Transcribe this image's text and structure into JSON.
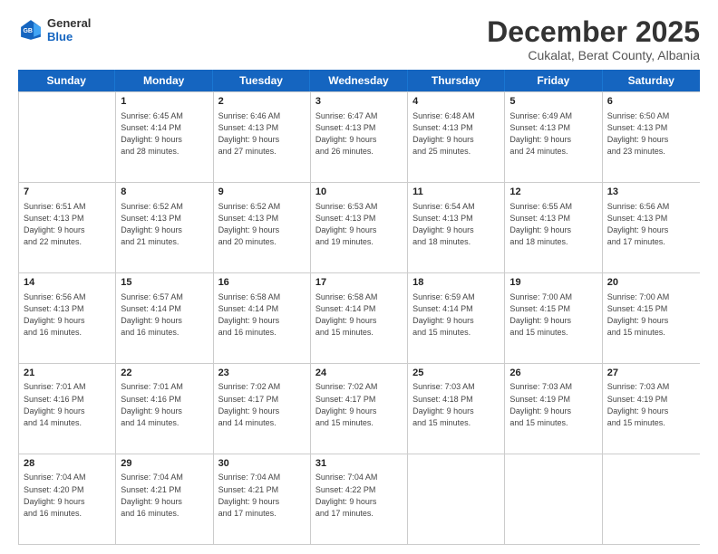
{
  "logo": {
    "line1": "General",
    "line2": "Blue"
  },
  "title": "December 2025",
  "subtitle": "Cukalat, Berat County, Albania",
  "header_days": [
    "Sunday",
    "Monday",
    "Tuesday",
    "Wednesday",
    "Thursday",
    "Friday",
    "Saturday"
  ],
  "weeks": [
    [
      {
        "day": "",
        "info": ""
      },
      {
        "day": "1",
        "info": "Sunrise: 6:45 AM\nSunset: 4:14 PM\nDaylight: 9 hours\nand 28 minutes."
      },
      {
        "day": "2",
        "info": "Sunrise: 6:46 AM\nSunset: 4:13 PM\nDaylight: 9 hours\nand 27 minutes."
      },
      {
        "day": "3",
        "info": "Sunrise: 6:47 AM\nSunset: 4:13 PM\nDaylight: 9 hours\nand 26 minutes."
      },
      {
        "day": "4",
        "info": "Sunrise: 6:48 AM\nSunset: 4:13 PM\nDaylight: 9 hours\nand 25 minutes."
      },
      {
        "day": "5",
        "info": "Sunrise: 6:49 AM\nSunset: 4:13 PM\nDaylight: 9 hours\nand 24 minutes."
      },
      {
        "day": "6",
        "info": "Sunrise: 6:50 AM\nSunset: 4:13 PM\nDaylight: 9 hours\nand 23 minutes."
      }
    ],
    [
      {
        "day": "7",
        "info": "Sunrise: 6:51 AM\nSunset: 4:13 PM\nDaylight: 9 hours\nand 22 minutes."
      },
      {
        "day": "8",
        "info": "Sunrise: 6:52 AM\nSunset: 4:13 PM\nDaylight: 9 hours\nand 21 minutes."
      },
      {
        "day": "9",
        "info": "Sunrise: 6:52 AM\nSunset: 4:13 PM\nDaylight: 9 hours\nand 20 minutes."
      },
      {
        "day": "10",
        "info": "Sunrise: 6:53 AM\nSunset: 4:13 PM\nDaylight: 9 hours\nand 19 minutes."
      },
      {
        "day": "11",
        "info": "Sunrise: 6:54 AM\nSunset: 4:13 PM\nDaylight: 9 hours\nand 18 minutes."
      },
      {
        "day": "12",
        "info": "Sunrise: 6:55 AM\nSunset: 4:13 PM\nDaylight: 9 hours\nand 18 minutes."
      },
      {
        "day": "13",
        "info": "Sunrise: 6:56 AM\nSunset: 4:13 PM\nDaylight: 9 hours\nand 17 minutes."
      }
    ],
    [
      {
        "day": "14",
        "info": "Sunrise: 6:56 AM\nSunset: 4:13 PM\nDaylight: 9 hours\nand 16 minutes."
      },
      {
        "day": "15",
        "info": "Sunrise: 6:57 AM\nSunset: 4:14 PM\nDaylight: 9 hours\nand 16 minutes."
      },
      {
        "day": "16",
        "info": "Sunrise: 6:58 AM\nSunset: 4:14 PM\nDaylight: 9 hours\nand 16 minutes."
      },
      {
        "day": "17",
        "info": "Sunrise: 6:58 AM\nSunset: 4:14 PM\nDaylight: 9 hours\nand 15 minutes."
      },
      {
        "day": "18",
        "info": "Sunrise: 6:59 AM\nSunset: 4:14 PM\nDaylight: 9 hours\nand 15 minutes."
      },
      {
        "day": "19",
        "info": "Sunrise: 7:00 AM\nSunset: 4:15 PM\nDaylight: 9 hours\nand 15 minutes."
      },
      {
        "day": "20",
        "info": "Sunrise: 7:00 AM\nSunset: 4:15 PM\nDaylight: 9 hours\nand 15 minutes."
      }
    ],
    [
      {
        "day": "21",
        "info": "Sunrise: 7:01 AM\nSunset: 4:16 PM\nDaylight: 9 hours\nand 14 minutes."
      },
      {
        "day": "22",
        "info": "Sunrise: 7:01 AM\nSunset: 4:16 PM\nDaylight: 9 hours\nand 14 minutes."
      },
      {
        "day": "23",
        "info": "Sunrise: 7:02 AM\nSunset: 4:17 PM\nDaylight: 9 hours\nand 14 minutes."
      },
      {
        "day": "24",
        "info": "Sunrise: 7:02 AM\nSunset: 4:17 PM\nDaylight: 9 hours\nand 15 minutes."
      },
      {
        "day": "25",
        "info": "Sunrise: 7:03 AM\nSunset: 4:18 PM\nDaylight: 9 hours\nand 15 minutes."
      },
      {
        "day": "26",
        "info": "Sunrise: 7:03 AM\nSunset: 4:19 PM\nDaylight: 9 hours\nand 15 minutes."
      },
      {
        "day": "27",
        "info": "Sunrise: 7:03 AM\nSunset: 4:19 PM\nDaylight: 9 hours\nand 15 minutes."
      }
    ],
    [
      {
        "day": "28",
        "info": "Sunrise: 7:04 AM\nSunset: 4:20 PM\nDaylight: 9 hours\nand 16 minutes."
      },
      {
        "day": "29",
        "info": "Sunrise: 7:04 AM\nSunset: 4:21 PM\nDaylight: 9 hours\nand 16 minutes."
      },
      {
        "day": "30",
        "info": "Sunrise: 7:04 AM\nSunset: 4:21 PM\nDaylight: 9 hours\nand 17 minutes."
      },
      {
        "day": "31",
        "info": "Sunrise: 7:04 AM\nSunset: 4:22 PM\nDaylight: 9 hours\nand 17 minutes."
      },
      {
        "day": "",
        "info": ""
      },
      {
        "day": "",
        "info": ""
      },
      {
        "day": "",
        "info": ""
      }
    ]
  ]
}
